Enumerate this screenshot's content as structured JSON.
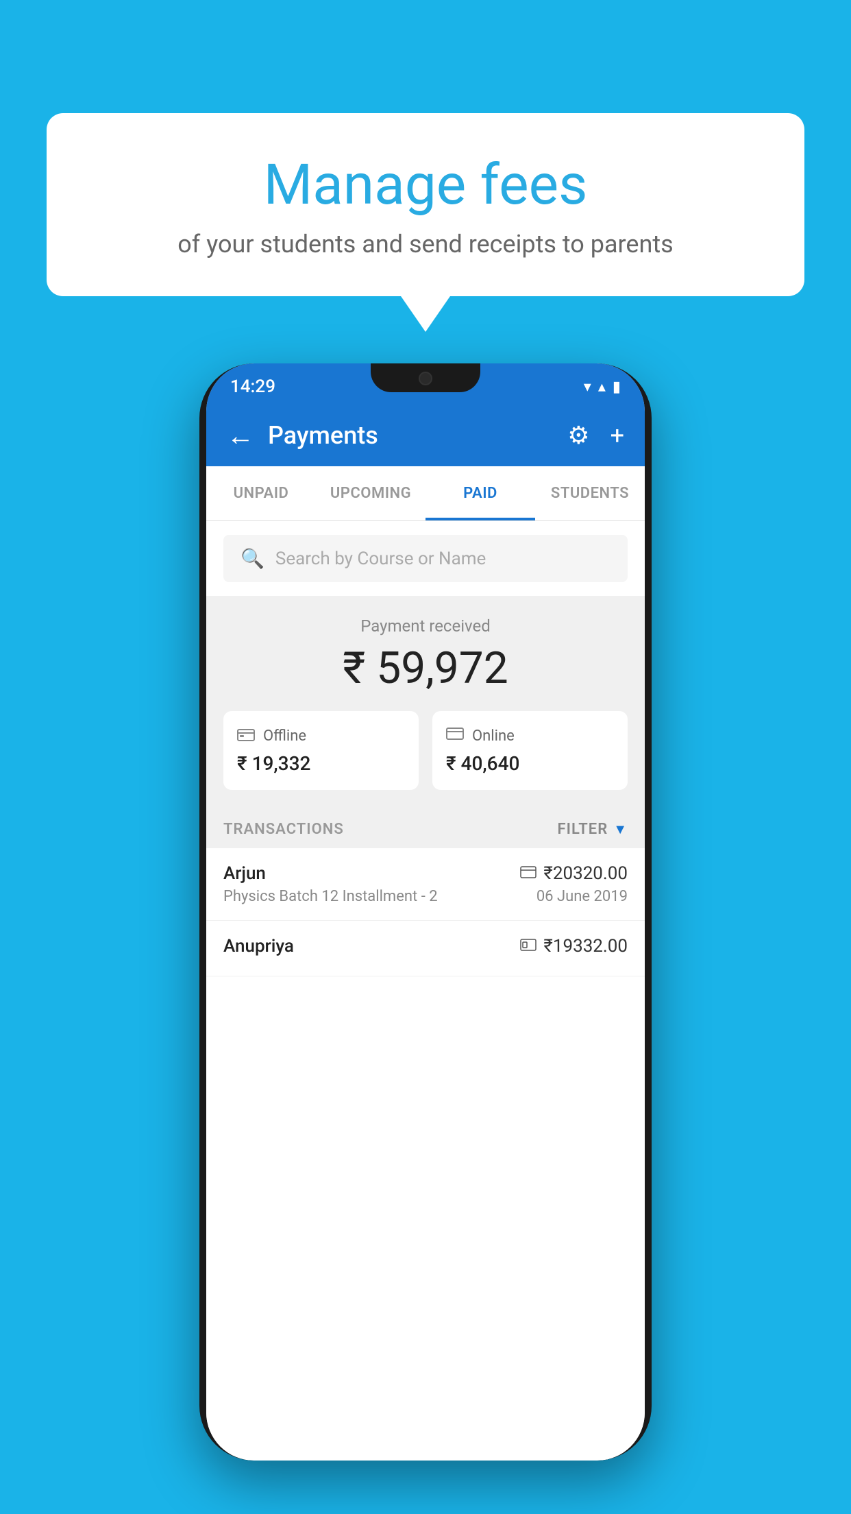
{
  "bubble": {
    "title": "Manage fees",
    "subtitle": "of your students and send receipts to parents"
  },
  "statusBar": {
    "time": "14:29",
    "icons": "▾ ▴ ▮"
  },
  "appBar": {
    "title": "Payments",
    "backArrow": "←",
    "settingsIcon": "⚙",
    "addIcon": "+"
  },
  "tabs": [
    {
      "label": "UNPAID",
      "active": false
    },
    {
      "label": "UPCOMING",
      "active": false
    },
    {
      "label": "PAID",
      "active": true
    },
    {
      "label": "STUDENTS",
      "active": false
    }
  ],
  "search": {
    "placeholder": "Search by Course or Name"
  },
  "paymentSummary": {
    "label": "Payment received",
    "amount": "₹ 59,972",
    "offline": {
      "icon": "🪙",
      "type": "Offline",
      "amount": "₹ 19,332"
    },
    "online": {
      "icon": "💳",
      "type": "Online",
      "amount": "₹ 40,640"
    }
  },
  "transactions": {
    "label": "TRANSACTIONS",
    "filterLabel": "FILTER",
    "items": [
      {
        "name": "Arjun",
        "amount": "₹20320.00",
        "iconType": "card",
        "course": "Physics Batch 12 Installment - 2",
        "date": "06 June 2019"
      },
      {
        "name": "Anupriya",
        "amount": "₹19332.00",
        "iconType": "cash",
        "course": "",
        "date": ""
      }
    ]
  }
}
